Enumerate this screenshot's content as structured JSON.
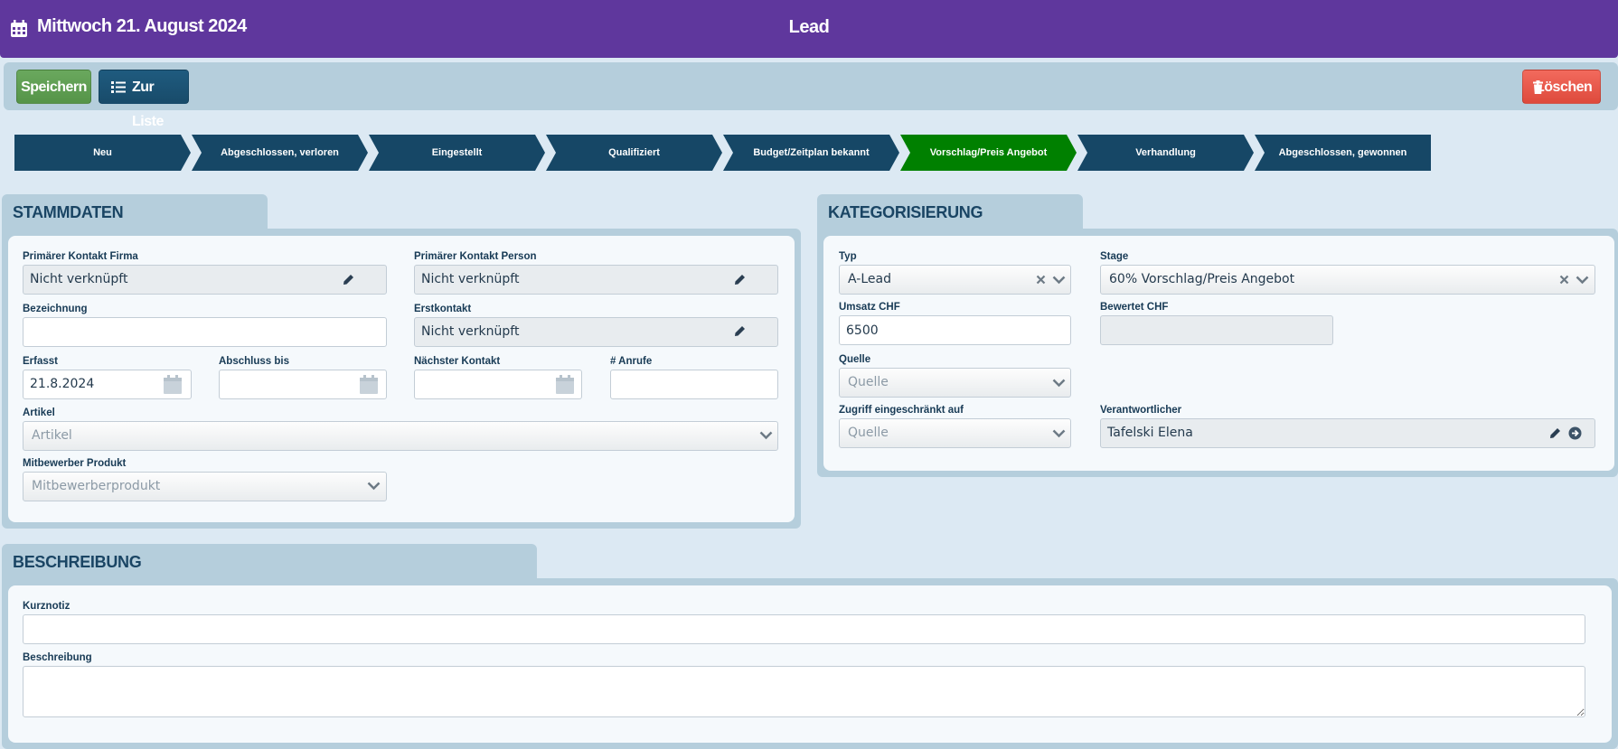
{
  "header": {
    "date": "Mittwoch 21. August 2024",
    "title": "Lead",
    "calendar_icon": "calendar-icon"
  },
  "toolbar": {
    "save_label": "Speichern",
    "list_label": "Zur Liste",
    "delete_label": "Löschen"
  },
  "colors": {
    "header_bg": "#5f379d",
    "stage_default": "#164766",
    "stage_active": "#008000",
    "save": "#5f9f53",
    "delete": "#e8554a"
  },
  "pipeline": {
    "active_index": 5,
    "stages": [
      {
        "label": "Neu"
      },
      {
        "label": "Abgeschlossen, verloren"
      },
      {
        "label": "Eingestellt"
      },
      {
        "label": "Qualifiziert"
      },
      {
        "label": "Budget/Zeitplan bekannt"
      },
      {
        "label": "Vorschlag/Preis Angebot"
      },
      {
        "label": "Verhandlung"
      },
      {
        "label": "Abgeschlossen, gewonnen"
      }
    ]
  },
  "stammdaten": {
    "title": "STAMMDATEN",
    "primaerer_kontakt_firma": {
      "label": "Primärer Kontakt Firma",
      "value": "Nicht verknüpft"
    },
    "primaerer_kontakt_person": {
      "label": "Primärer Kontakt Person",
      "value": "Nicht verknüpft"
    },
    "bezeichnung": {
      "label": "Bezeichnung",
      "value": ""
    },
    "erstkontakt": {
      "label": "Erstkontakt",
      "value": "Nicht verknüpft"
    },
    "erfasst": {
      "label": "Erfasst",
      "value": "21.8.2024"
    },
    "abschluss_bis": {
      "label": "Abschluss bis",
      "value": ""
    },
    "naechster_kontakt": {
      "label": "Nächster Kontakt",
      "value": ""
    },
    "anrufe": {
      "label": "# Anrufe",
      "value": ""
    },
    "artikel": {
      "label": "Artikel",
      "placeholder": "Artikel"
    },
    "mitbewerber_produkt": {
      "label": "Mitbewerber Produkt",
      "placeholder": "Mitbewerberprodukt"
    }
  },
  "kategorisierung": {
    "title": "KATEGORISIERUNG",
    "typ": {
      "label": "Typ",
      "value": "A-Lead"
    },
    "stage": {
      "label": "Stage",
      "value": "60% Vorschlag/Preis Angebot"
    },
    "umsatz": {
      "label": "Umsatz CHF",
      "value": "6500"
    },
    "bewertet": {
      "label": "Bewertet CHF",
      "value": ""
    },
    "quelle": {
      "label": "Quelle",
      "placeholder": "Quelle"
    },
    "zugriff": {
      "label": "Zugriff eingeschränkt auf",
      "placeholder": "Quelle"
    },
    "verantwortlicher": {
      "label": "Verantwortlicher",
      "value": "Tafelski Elena"
    }
  },
  "beschreibung": {
    "title": "BESCHREIBUNG",
    "kurznotiz": {
      "label": "Kurznotiz",
      "value": ""
    },
    "beschreibung": {
      "label": "Beschreibung",
      "value": ""
    }
  }
}
